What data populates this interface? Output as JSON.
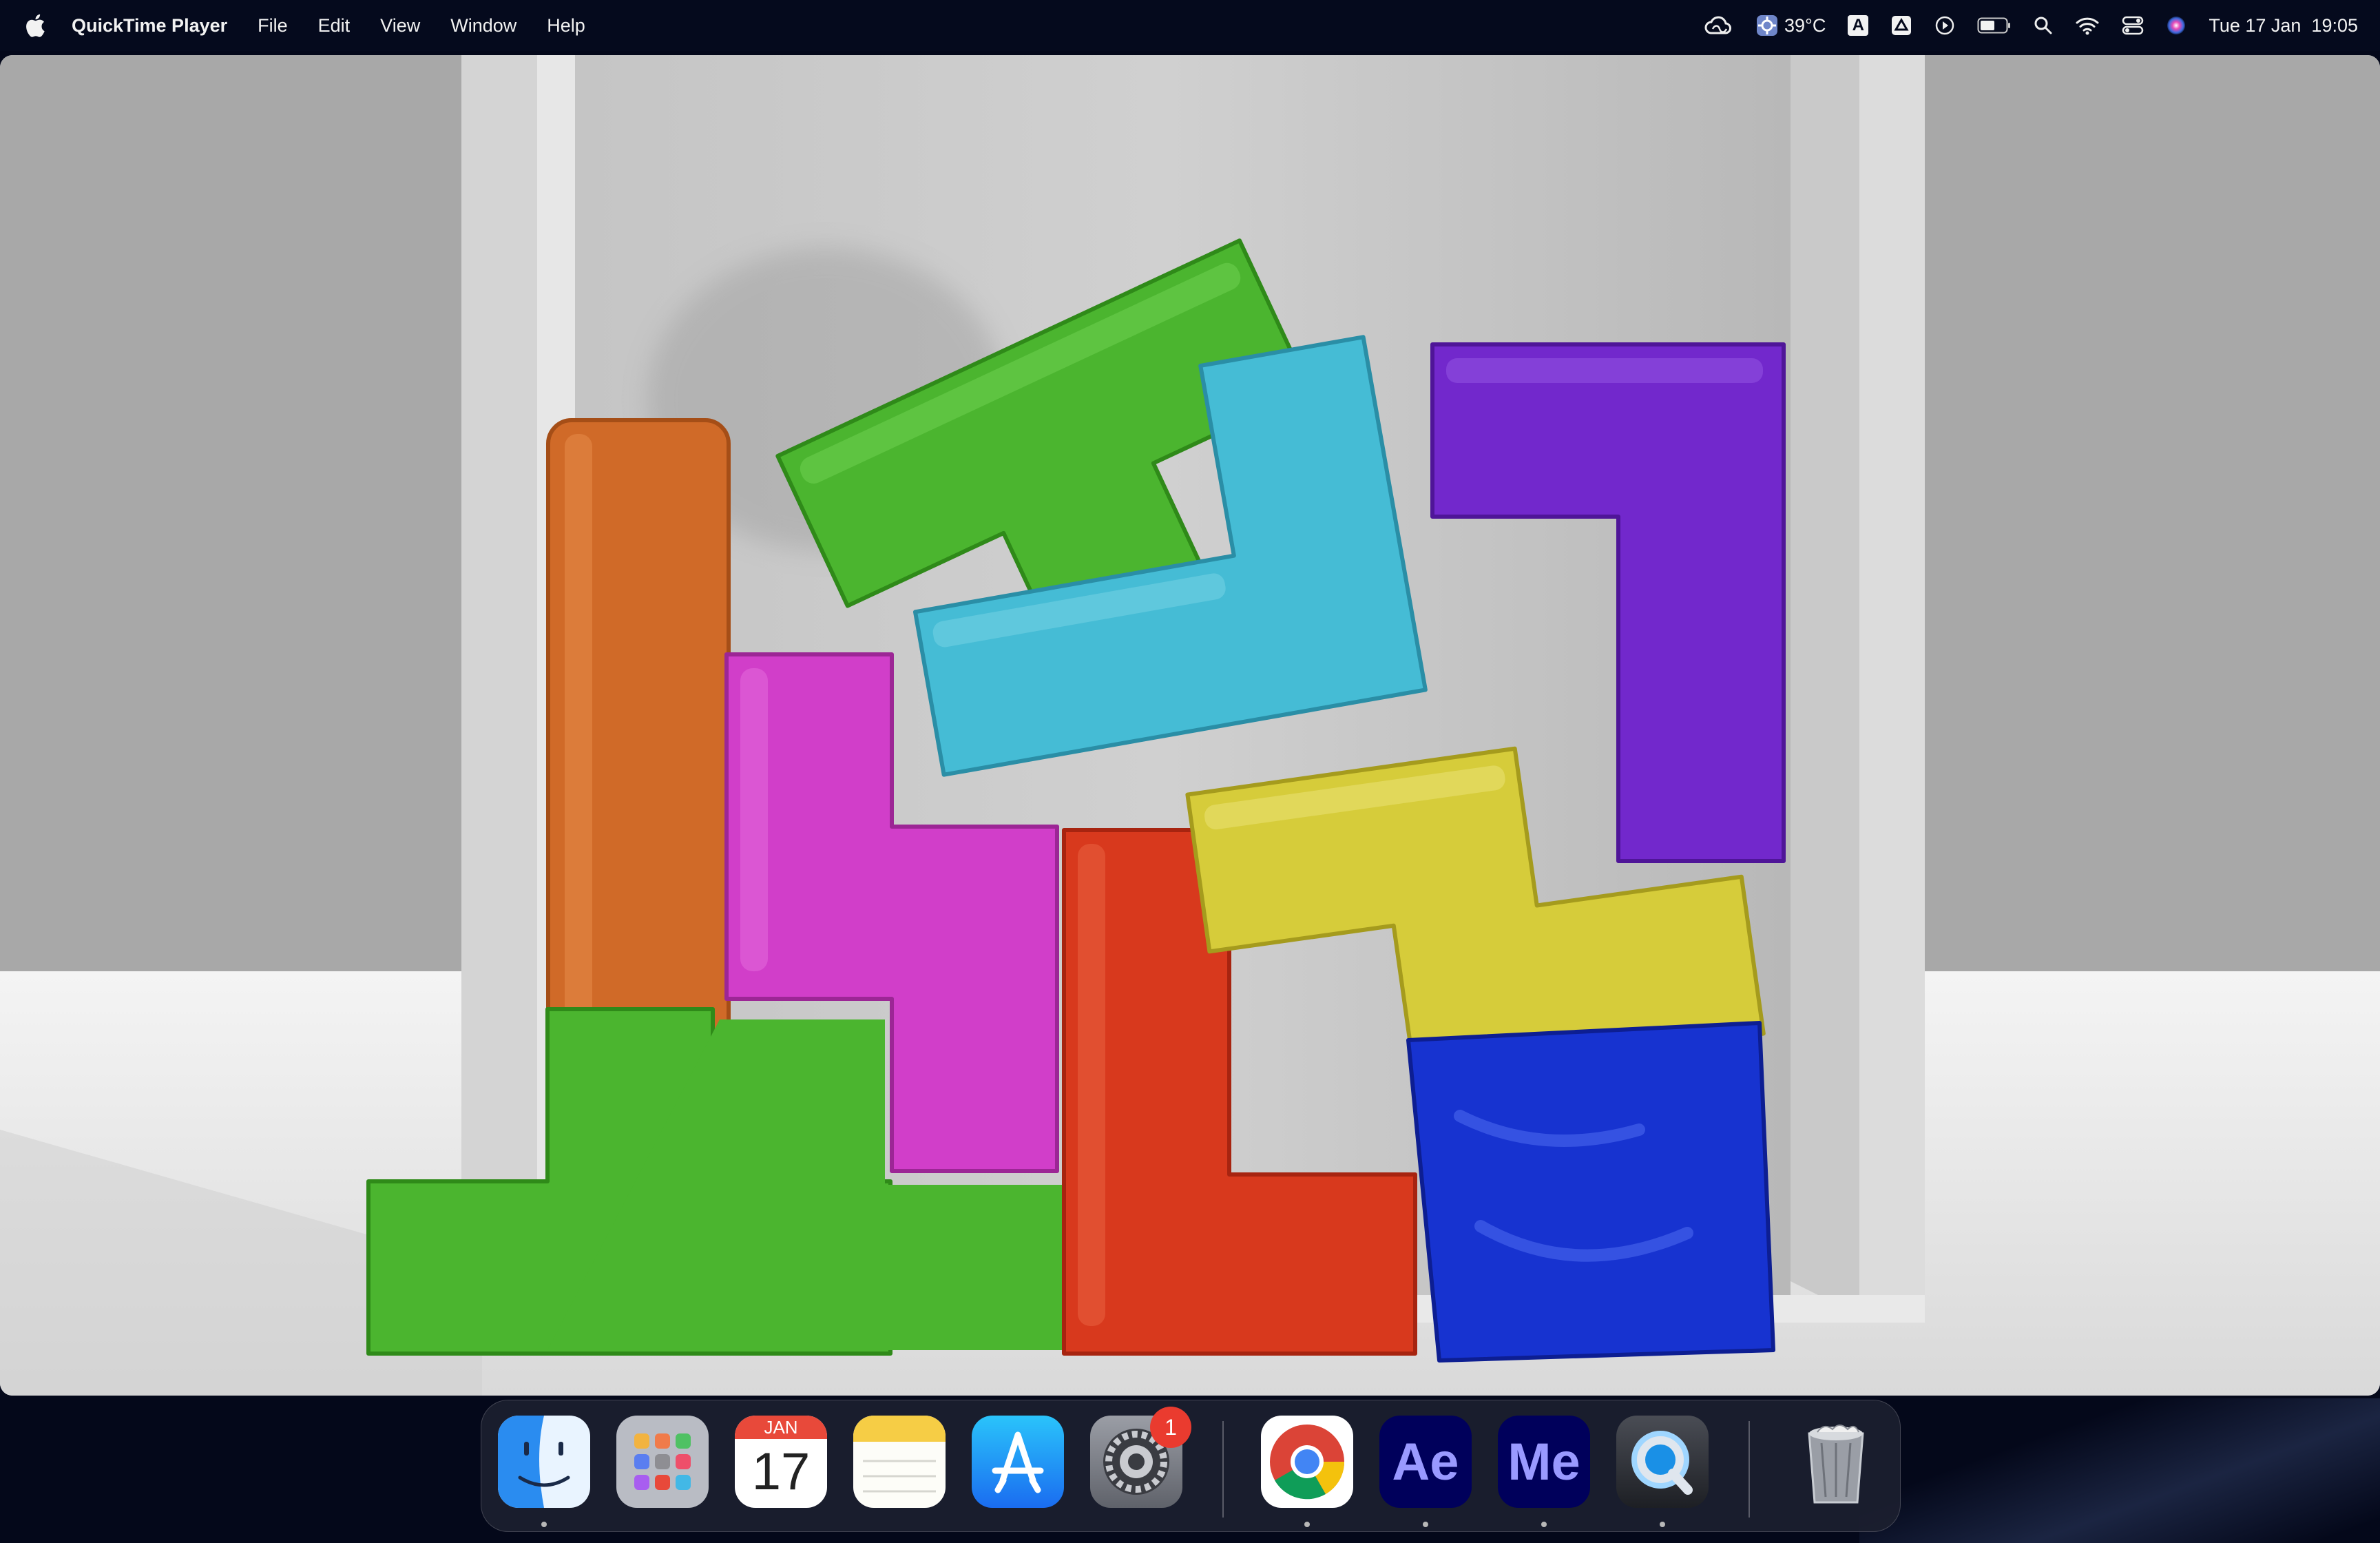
{
  "menubar": {
    "app_name": "QuickTime Player",
    "menus": [
      "File",
      "Edit",
      "View",
      "Window",
      "Help"
    ],
    "status": {
      "weather": "39°C",
      "datetime": "Tue 17 Jan  19:05",
      "input_source": "A"
    }
  },
  "window": {
    "title": "QuickTime Player",
    "content": "video frame: stacked soft 3D tetris blocks in a white box",
    "colors": {
      "orange": "#d06a28",
      "green": "#4bb52f",
      "magenta": "#d13ec9",
      "cyan": "#45bcd5",
      "purple": "#7228cc",
      "red": "#d8391d",
      "yellow": "#d6cc3a",
      "blue": "#1733d0"
    }
  },
  "dock": {
    "apps": [
      {
        "name": "Finder",
        "running": true
      },
      {
        "name": "Launchpad",
        "running": false
      },
      {
        "name": "Calendar",
        "running": false,
        "month": "JAN",
        "day": "17"
      },
      {
        "name": "Notes",
        "running": false
      },
      {
        "name": "App Store",
        "running": false
      },
      {
        "name": "System Settings",
        "running": false,
        "badge": "1"
      },
      {
        "name": "Google Chrome",
        "running": true
      },
      {
        "name": "Adobe After Effects",
        "running": true,
        "label": "Ae"
      },
      {
        "name": "Adobe Media Encoder",
        "running": true,
        "label": "Me"
      },
      {
        "name": "QuickTime Player",
        "running": true
      },
      {
        "name": "Trash",
        "running": false
      }
    ]
  }
}
